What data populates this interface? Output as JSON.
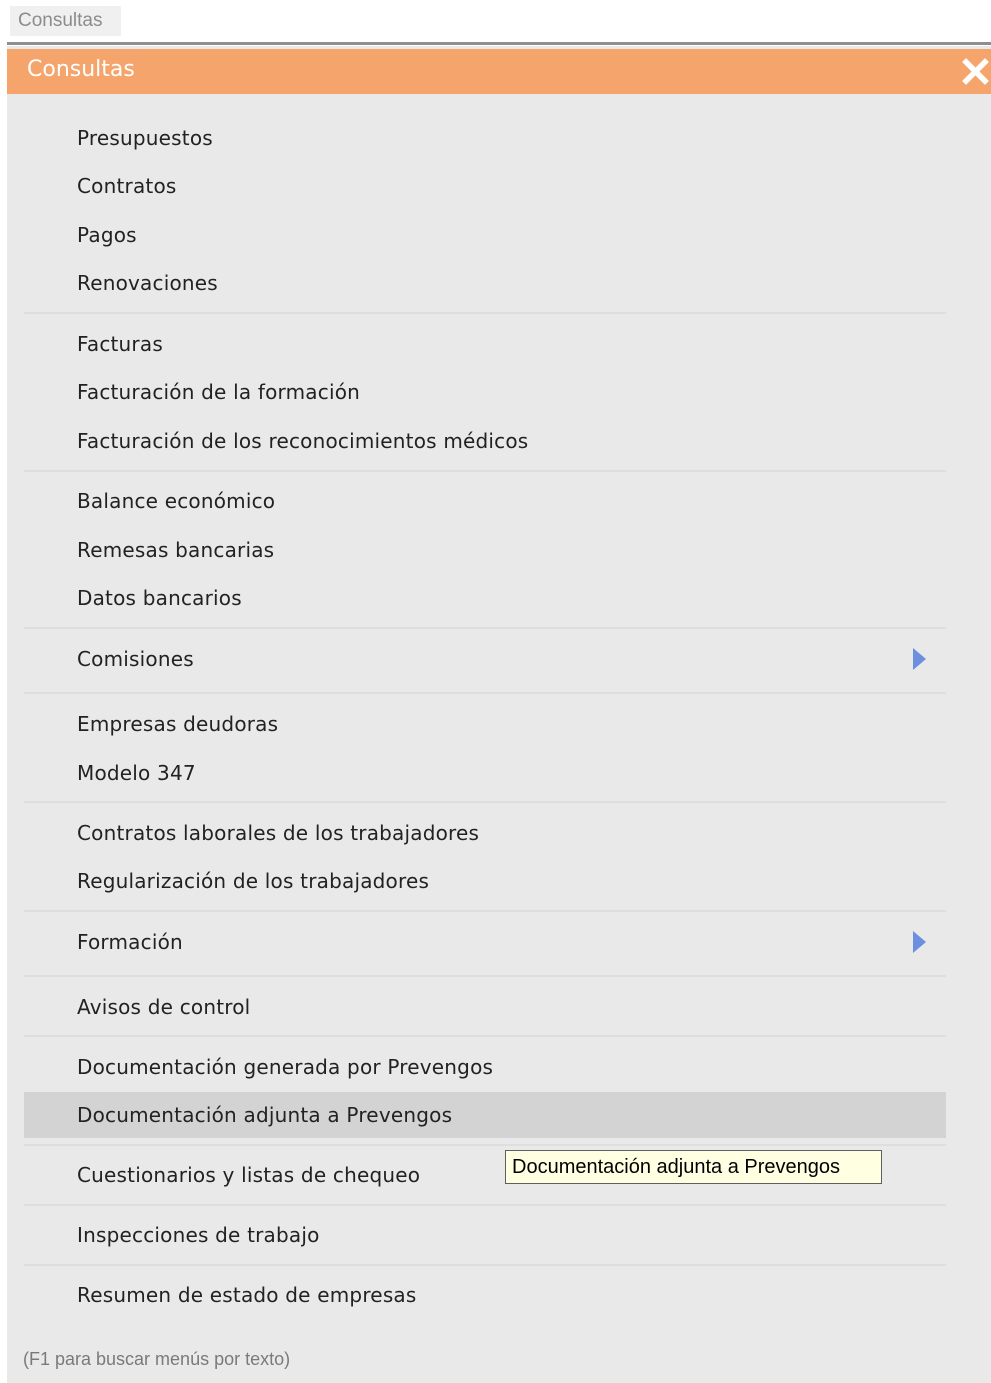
{
  "top_tab": {
    "label": "Consultas"
  },
  "window": {
    "title": "Consultas",
    "close_icon": "close-x-icon"
  },
  "menu": {
    "items": [
      {
        "label": "Presupuestos"
      },
      {
        "label": "Contratos"
      },
      {
        "label": "Pagos"
      },
      {
        "label": "Renovaciones"
      },
      {
        "label": "Facturas"
      },
      {
        "label": "Facturación de la formación"
      },
      {
        "label": "Facturación de los reconocimientos médicos"
      },
      {
        "label": "Balance económico"
      },
      {
        "label": "Remesas bancarias"
      },
      {
        "label": "Datos bancarios"
      },
      {
        "label": "Comisiones",
        "submenu": true
      },
      {
        "label": "Empresas deudoras"
      },
      {
        "label": "Modelo 347"
      },
      {
        "label": "Contratos laborales de los trabajadores"
      },
      {
        "label": "Regularización de los trabajadores"
      },
      {
        "label": "Formación",
        "submenu": true
      },
      {
        "label": "Avisos de control"
      },
      {
        "label": "Documentación generada por Prevengos"
      },
      {
        "label": "Documentación adjunta a Prevengos",
        "highlighted": true
      },
      {
        "label": "Cuestionarios y listas de chequeo"
      },
      {
        "label": "Inspecciones de trabajo"
      },
      {
        "label": "Resumen de estado de empresas"
      }
    ]
  },
  "tooltip": {
    "text": "Documentación adjunta a Prevengos"
  },
  "footer": {
    "hint": "(F1 para buscar menús por texto)"
  },
  "colors": {
    "title_bar": "#f5a56c",
    "panel_bg": "#e9e9e9",
    "highlight": "#d3d3d3",
    "submenu_arrow": "#6d8fe0",
    "tooltip_bg": "#ffffe1"
  }
}
